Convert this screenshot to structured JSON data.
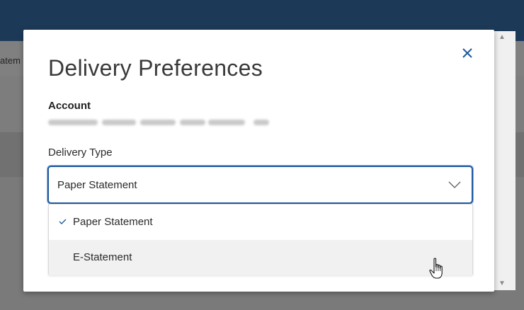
{
  "background": {
    "partial_text": "atem"
  },
  "modal": {
    "title": "Delivery Preferences",
    "account_label": "Account",
    "delivery_type_label": "Delivery Type",
    "select": {
      "selected_value": "Paper Statement"
    },
    "options": [
      {
        "label": "Paper Statement",
        "selected": true
      },
      {
        "label": "E-Statement",
        "hovered": true
      }
    ]
  },
  "colors": {
    "header_bar": "#1c3a58",
    "close_icon": "#1f5a9e",
    "select_border": "#1f5a9e"
  },
  "icons": {
    "close": "close-icon",
    "chevron": "chevron-down-icon",
    "check": "check-icon",
    "cursor": "hand-pointer-icon"
  }
}
